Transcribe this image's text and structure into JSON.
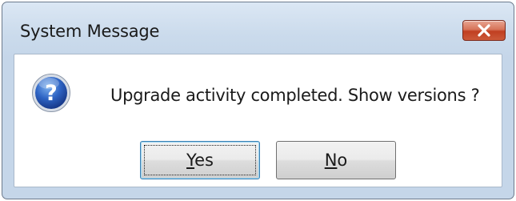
{
  "window": {
    "title": "System Message",
    "close_icon": "close-x-icon",
    "close_color": "#c7462a"
  },
  "message": {
    "icon": "question-icon",
    "text": "Upgrade activity completed. Show versions ?"
  },
  "buttons": {
    "yes": {
      "mnemonic": "Y",
      "rest": "es",
      "focused": true
    },
    "no": {
      "mnemonic": "N",
      "rest": "o",
      "focused": false
    }
  }
}
